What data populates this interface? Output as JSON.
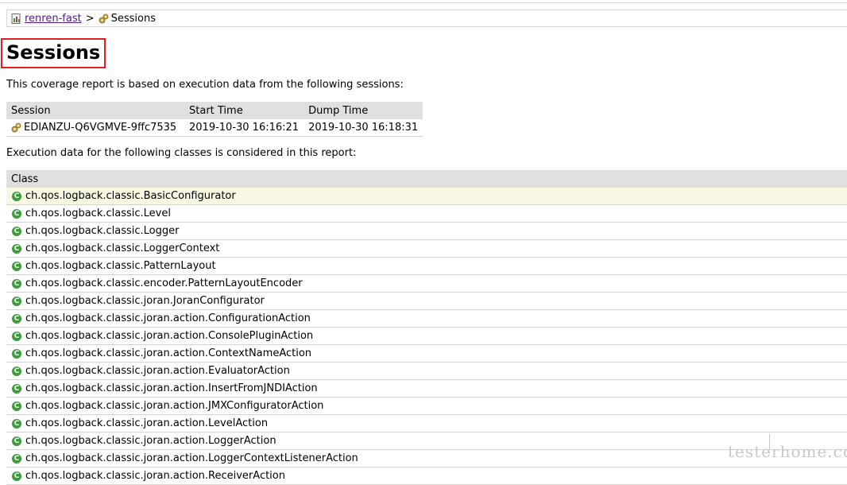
{
  "breadcrumb": {
    "root": "renren-fast",
    "separator": ">",
    "current": "Sessions"
  },
  "title": "Sessions",
  "sessions_intro": "This coverage report is based on execution data from the following sessions:",
  "sessions_table": {
    "headers": [
      "Session",
      "Start Time",
      "Dump Time"
    ],
    "rows": [
      {
        "session": "EDIANZU-Q6VGMVE-9ffc7535",
        "start": "2019-10-30 16:16:21",
        "dump": "2019-10-30 16:18:31"
      }
    ]
  },
  "classes_intro": "Execution data for the following classes is considered in this report:",
  "classes_table": {
    "header": "Class",
    "icon_glyph": "C",
    "rows": [
      "ch.qos.logback.classic.BasicConfigurator",
      "ch.qos.logback.classic.Level",
      "ch.qos.logback.classic.Logger",
      "ch.qos.logback.classic.LoggerContext",
      "ch.qos.logback.classic.PatternLayout",
      "ch.qos.logback.classic.encoder.PatternLayoutEncoder",
      "ch.qos.logback.classic.joran.JoranConfigurator",
      "ch.qos.logback.classic.joran.action.ConfigurationAction",
      "ch.qos.logback.classic.joran.action.ConsolePluginAction",
      "ch.qos.logback.classic.joran.action.ContextNameAction",
      "ch.qos.logback.classic.joran.action.EvaluatorAction",
      "ch.qos.logback.classic.joran.action.InsertFromJNDIAction",
      "ch.qos.logback.classic.joran.action.JMXConfiguratorAction",
      "ch.qos.logback.classic.joran.action.LevelAction",
      "ch.qos.logback.classic.joran.action.LoggerAction",
      "ch.qos.logback.classic.joran.action.LoggerContextListenerAction",
      "ch.qos.logback.classic.joran.action.ReceiverAction"
    ]
  },
  "watermark": "testerhome.com",
  "colors": {
    "highlight_row": "#f7f7e4",
    "header_bg": "#e0e0e0",
    "class_icon": "#3d9b3a",
    "annotation_box": "#e02020",
    "link": "#551a8b"
  }
}
